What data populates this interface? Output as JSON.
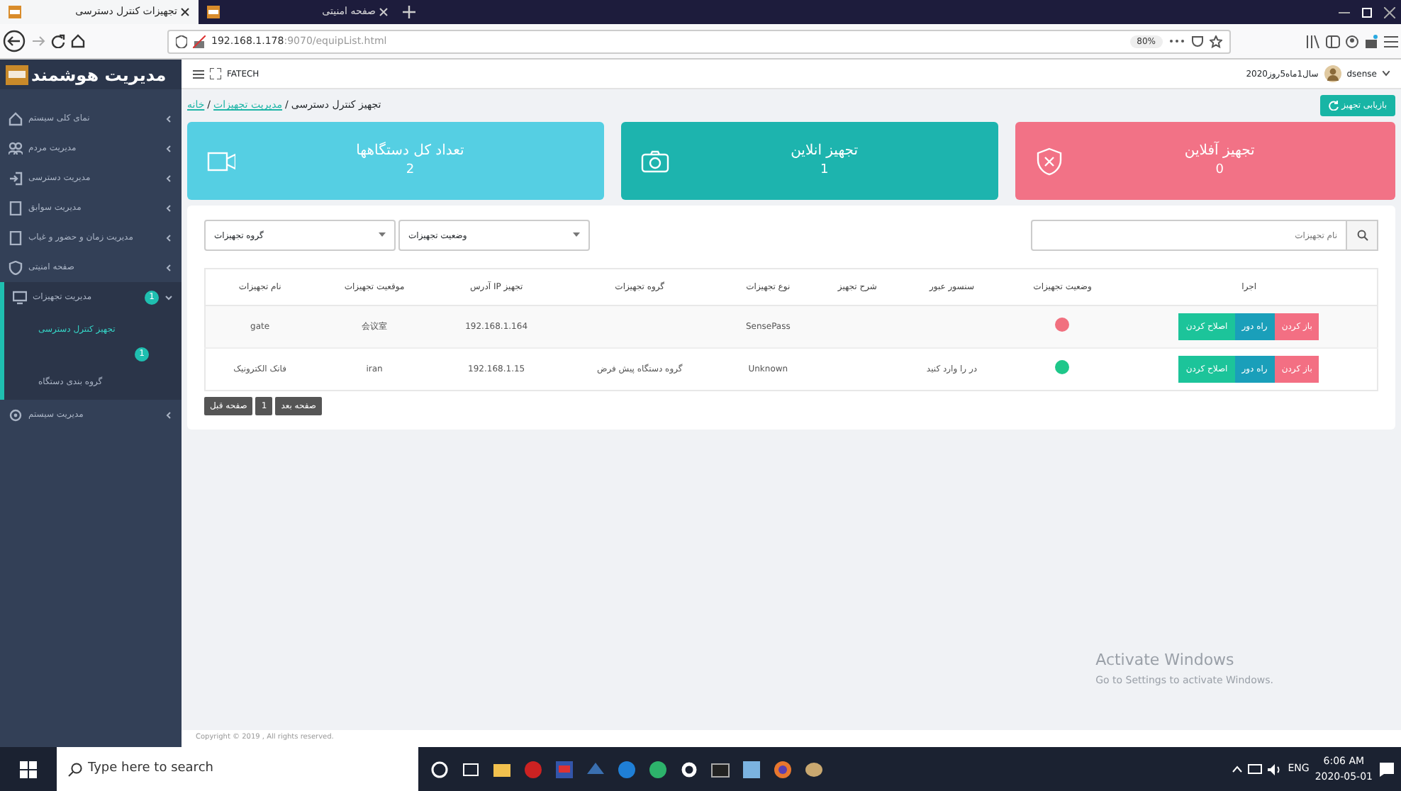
{
  "browser": {
    "tabs": [
      {
        "label": "صفحه امنیتی",
        "selected": false
      },
      {
        "label": "تجهیزات کنترل دسترسی",
        "selected": true
      }
    ],
    "url": {
      "host": "192.168.1.178",
      "path": ":9070/equipList.html"
    },
    "zoom": "80%"
  },
  "brand": "مدیریت هوشمند",
  "header": {
    "company": "FATECH",
    "date": "سال1ماه5روز2020",
    "user": "dsense"
  },
  "sidebar": {
    "items": [
      {
        "label": "نمای کلی سیستم",
        "expanded": false
      },
      {
        "label": "مدیریت مردم",
        "expanded": false
      },
      {
        "label": "مدیریت دسترسی",
        "expanded": false
      },
      {
        "label": "مدیریت سوابق",
        "expanded": false
      },
      {
        "label": "مدیریت زمان و حضور و غیاب",
        "expanded": false
      },
      {
        "label": "صفحه امنیتی",
        "expanded": false
      },
      {
        "label": "مدیریت تجهیزات",
        "expanded": true,
        "badge": "1",
        "children": [
          {
            "label": "تجهیز کنترل دسترسی",
            "selected": true,
            "badge": "1"
          },
          {
            "label": "گروه بندی دستگاه",
            "selected": false
          }
        ]
      },
      {
        "label": "مدیریت سیستم",
        "expanded": false
      }
    ]
  },
  "breadcrumb": {
    "separator": "/",
    "items": [
      {
        "label": "تجهیز کنترل دسترسی",
        "kind": "current"
      },
      {
        "label": "مدیریت تجهیزات",
        "kind": "link"
      },
      {
        "label": "خانه",
        "kind": "link"
      }
    ]
  },
  "refresh_button": "بازیابی تجهیز",
  "stat_cards": [
    {
      "title": "تجهیز آفلاین",
      "value": "0",
      "kind": "offline"
    },
    {
      "title": "تجهیز انلاین",
      "value": "1",
      "kind": "online"
    },
    {
      "title": "تعداد کل دستگاهها",
      "value": "2",
      "kind": "total"
    }
  ],
  "filters": {
    "group_select": "گروه تجهیزات",
    "status_select": "وضعیت تجهیزات",
    "search_placeholder": "نام تجهیزات"
  },
  "table": {
    "columns": [
      "اجرا",
      "وضعیت تجهیزات",
      "سنسور عبور",
      "شرح تجهیز",
      "نوع تجهیزات",
      "گروه تجهیزات",
      "تجهیز IP آدرس",
      "موقعیت تجهیزات",
      "نام تجهیزات"
    ],
    "rows": [
      {
        "cells": [
          {
            "kind": "actions",
            "buttons": [
              {
                "label": "باز کردن",
                "kind": "open"
              },
              {
                "label": "راه دور",
                "kind": "remote"
              },
              {
                "label": "اصلاح کردن",
                "kind": "edit"
              }
            ]
          },
          {
            "kind": "status",
            "online": false
          },
          {
            "kind": "text",
            "text": ""
          },
          {
            "kind": "text",
            "text": ""
          },
          {
            "kind": "text",
            "text": "SensePass"
          },
          {
            "kind": "text",
            "text": ""
          },
          {
            "kind": "text",
            "text": "192.168.1.164"
          },
          {
            "kind": "text",
            "text": "会议室"
          },
          {
            "kind": "text",
            "text": "gate"
          }
        ]
      },
      {
        "cells": [
          {
            "kind": "actions",
            "buttons": [
              {
                "label": "باز کردن",
                "kind": "open"
              },
              {
                "label": "راه دور",
                "kind": "remote"
              },
              {
                "label": "اصلاح کردن",
                "kind": "edit"
              }
            ]
          },
          {
            "kind": "status",
            "online": true
          },
          {
            "kind": "text",
            "text": "در را وارد کنید"
          },
          {
            "kind": "text",
            "text": ""
          },
          {
            "kind": "text",
            "text": "Unknown"
          },
          {
            "kind": "text",
            "text": "گروه دستگاه پیش فرض"
          },
          {
            "kind": "text",
            "text": "192.168.1.15"
          },
          {
            "kind": "text",
            "text": "iran"
          },
          {
            "kind": "text",
            "text": "فانک الکترونیک"
          }
        ]
      }
    ]
  },
  "pagination": [
    "صفحه بعد",
    "1",
    "صفحه قبل"
  ],
  "footer": "Copyright © 2019 , All rights reserved.",
  "activation": {
    "title": "Activate Windows",
    "subtitle": "Go to Settings to activate Windows."
  },
  "taskbar": {
    "search_placeholder": "Type here to search",
    "language": "ENG",
    "time": "6:06 AM",
    "date": "2020-05-01"
  }
}
